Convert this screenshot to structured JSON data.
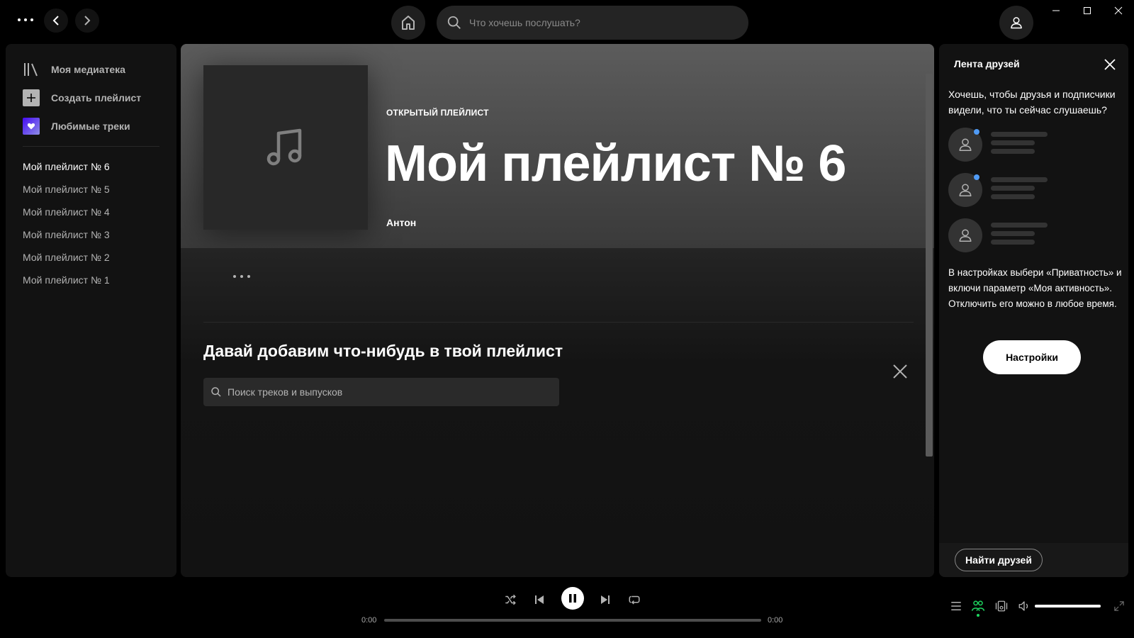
{
  "topbar": {
    "search_placeholder": "Что хочешь послушать?"
  },
  "sidebar": {
    "library_label": "Моя медиатека",
    "create_label": "Создать плейлист",
    "liked_label": "Любимые треки",
    "playlists": [
      "Мой плейлист № 6",
      "Мой плейлист № 5",
      "Мой плейлист № 4",
      "Мой плейлист № 3",
      "Мой плейлист № 2",
      "Мой плейлист № 1"
    ],
    "active_index": 0
  },
  "playlist": {
    "type_label": "ОТКРЫТЫЙ ПЛЕЙЛИСТ",
    "title": "Мой плейлист № 6",
    "owner": "Антон",
    "add_title": "Давай добавим что-нибудь в твой плейлист",
    "search_placeholder": "Поиск треков и выпусков"
  },
  "friends": {
    "title": "Лента друзей",
    "prompt": "Хочешь, чтобы друзья и подписчики видели, что ты сейчас слушаешь?",
    "instructions": "В настройках выбери «Приватность» и включи параметр «Моя активность». Отключить его можно в любое время.",
    "settings_label": "Настройки",
    "find_friends_label": "Найти друзей"
  },
  "player": {
    "time_elapsed": "0:00",
    "time_total": "0:00",
    "progress": 0,
    "volume": 1.0,
    "state": "playing"
  },
  "colors": {
    "accent": "#1ed760",
    "friend_dot": "#509bf5"
  },
  "icons": [
    "menu-dots-icon",
    "chevron-left-icon",
    "chevron-right-icon",
    "home-icon",
    "search-icon",
    "user-icon",
    "minimize-icon",
    "maximize-icon",
    "close-icon",
    "library-icon",
    "plus-icon",
    "heart-icon",
    "music-note-icon",
    "more-dots-icon",
    "shuffle-icon",
    "previous-icon",
    "pause-icon",
    "next-icon",
    "repeat-icon",
    "queue-icon",
    "friends-icon",
    "devices-icon",
    "volume-icon",
    "fullscreen-icon"
  ]
}
